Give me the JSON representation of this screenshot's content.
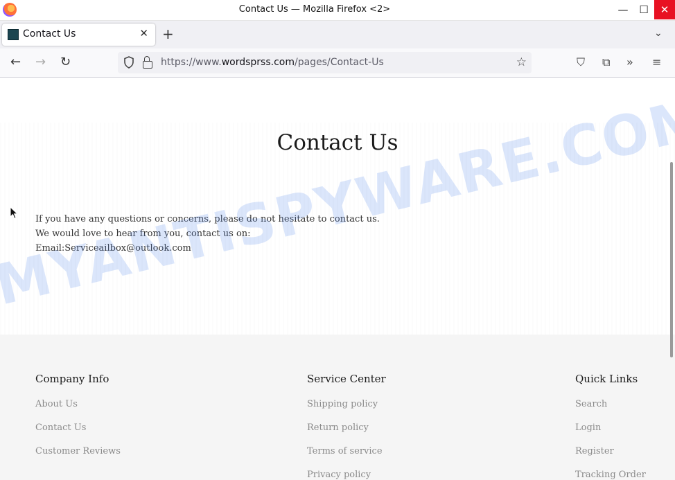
{
  "window": {
    "title": "Contact Us — Mozilla Firefox <2>",
    "controls": {
      "minimize": "—",
      "maximize": "☐",
      "close": "✕"
    }
  },
  "tab": {
    "title": "Contact Us",
    "close": "✕",
    "new_tab": "+",
    "list_all": "⌄"
  },
  "nav": {
    "back": "←",
    "forward": "→",
    "reload": "↻",
    "url_prefix": "https://www.",
    "url_domain": "wordsprss.com",
    "url_path": "/pages/Contact-Us",
    "star": "☆",
    "pocket": "⛉",
    "extensions": "⧉",
    "overflow": "»",
    "menu": "≡"
  },
  "page": {
    "heading": "Contact Us",
    "lines": [
      "If you have any questions or concerns, please do not hesitate to contact us.",
      "We would love to hear from you, contact us on:",
      "Email:Serviceailbox@outlook.com"
    ],
    "watermark": "MYANTISPYWARE.COM"
  },
  "footer": {
    "company": {
      "heading": "Company Info",
      "links": [
        "About Us",
        "Contact Us",
        "Customer Reviews"
      ]
    },
    "service": {
      "heading": "Service Center",
      "links": [
        "Shipping policy",
        "Return policy",
        "Terms of service",
        "Privacy policy"
      ]
    },
    "quick": {
      "heading": "Quick Links",
      "links": [
        "Search",
        "Login",
        "Register",
        "Tracking Order"
      ]
    }
  },
  "colors": {
    "close_button": "#e81123",
    "watermark": "#5a8ceb",
    "footer_bg": "#f5f5f5"
  }
}
